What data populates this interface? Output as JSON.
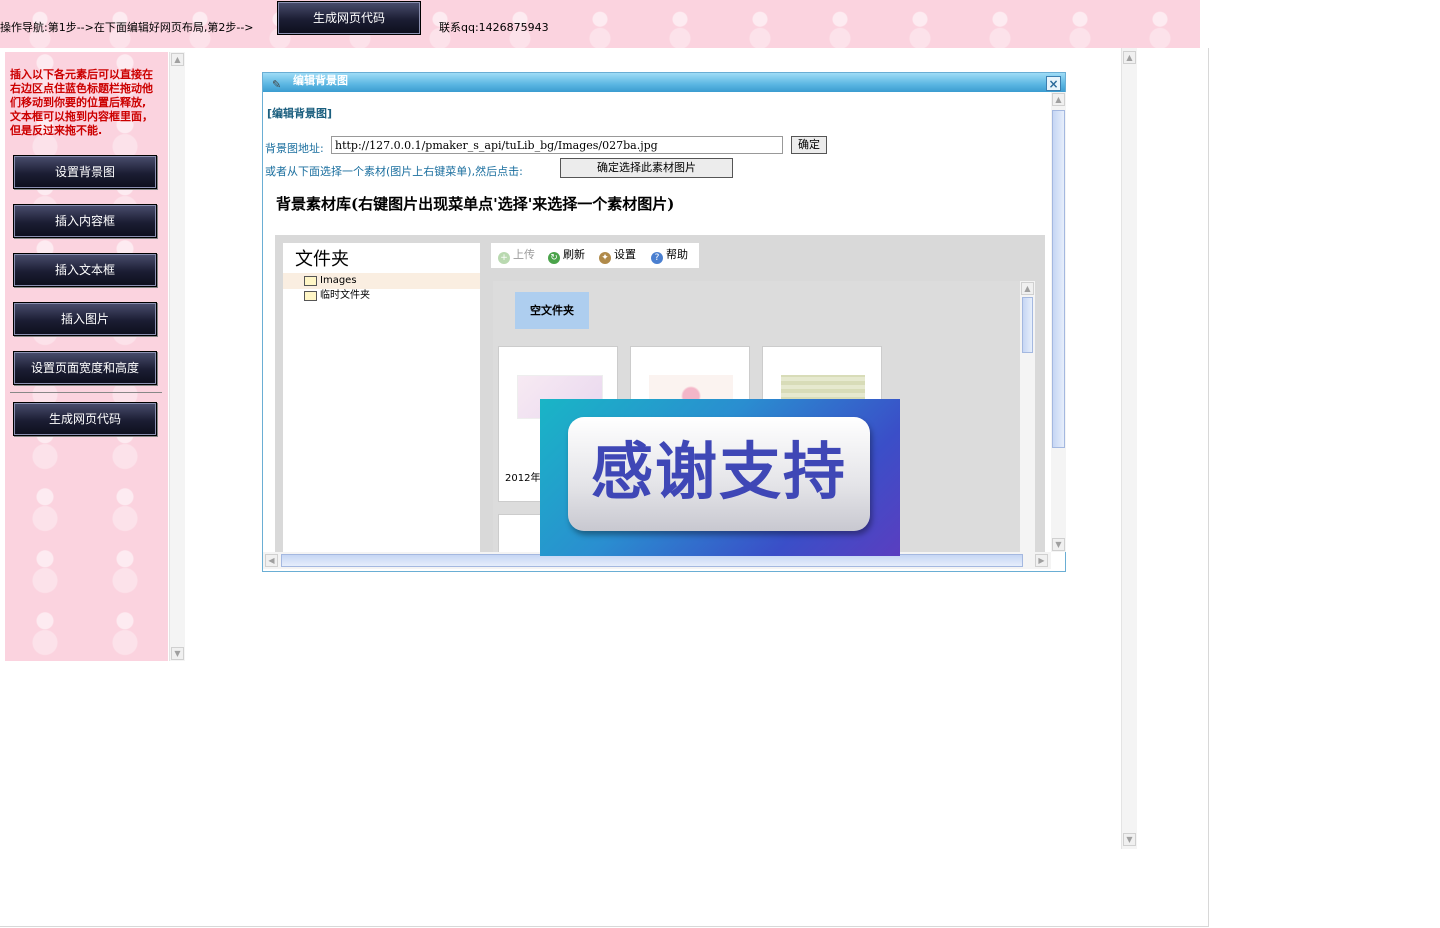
{
  "topbar": {
    "nav_text": "操作导航:第1步-->在下面编辑好网页布局,第2步-->",
    "generate_button": "生成网页代码",
    "contact": "联系qq:1426875943"
  },
  "sidebar": {
    "hint": "插入以下各元素后可以直接在右边区点住蓝色标题栏拖动他们移动到你要的位置后释放, 文本框可以拖到内容框里面，但是反过来拖不能.",
    "buttons": [
      "设置背景图",
      "插入内容框",
      "插入文本框",
      "插入图片",
      "设置页面宽度和高度",
      "生成网页代码"
    ]
  },
  "dialog": {
    "title": "编辑背景图",
    "heading": "[编辑背景图]",
    "url_label": "背景图地址:",
    "url_value": "http://127.0.0.1/pmaker_s_api/tuLib_bg/Images/027ba.jpg",
    "ok_button": "确定",
    "or_label": "或者从下面选择一个素材(图片上右键菜单),然后点击:",
    "choose_button": "确定选择此素材图片",
    "library_title": "背景素材库(右键图片出现菜单点'选择'来选择一个素材图片)"
  },
  "file_manager": {
    "tree_title": "文件夹",
    "folders": [
      "Images",
      "临时文件夹"
    ],
    "selected_folder": "Images",
    "toolbar": [
      "上传",
      "刷新",
      "设置",
      "帮助"
    ],
    "empty_folder_label": "空文件夹",
    "thumb_caption": "2012年"
  },
  "overlay": {
    "text": "感谢支持"
  },
  "colors": {
    "pink_bg": "#fbd3df",
    "hint_red": "#cc0000",
    "dialog_title_blue": "#5bb6e2",
    "overlay_text": "#3f47b6"
  }
}
